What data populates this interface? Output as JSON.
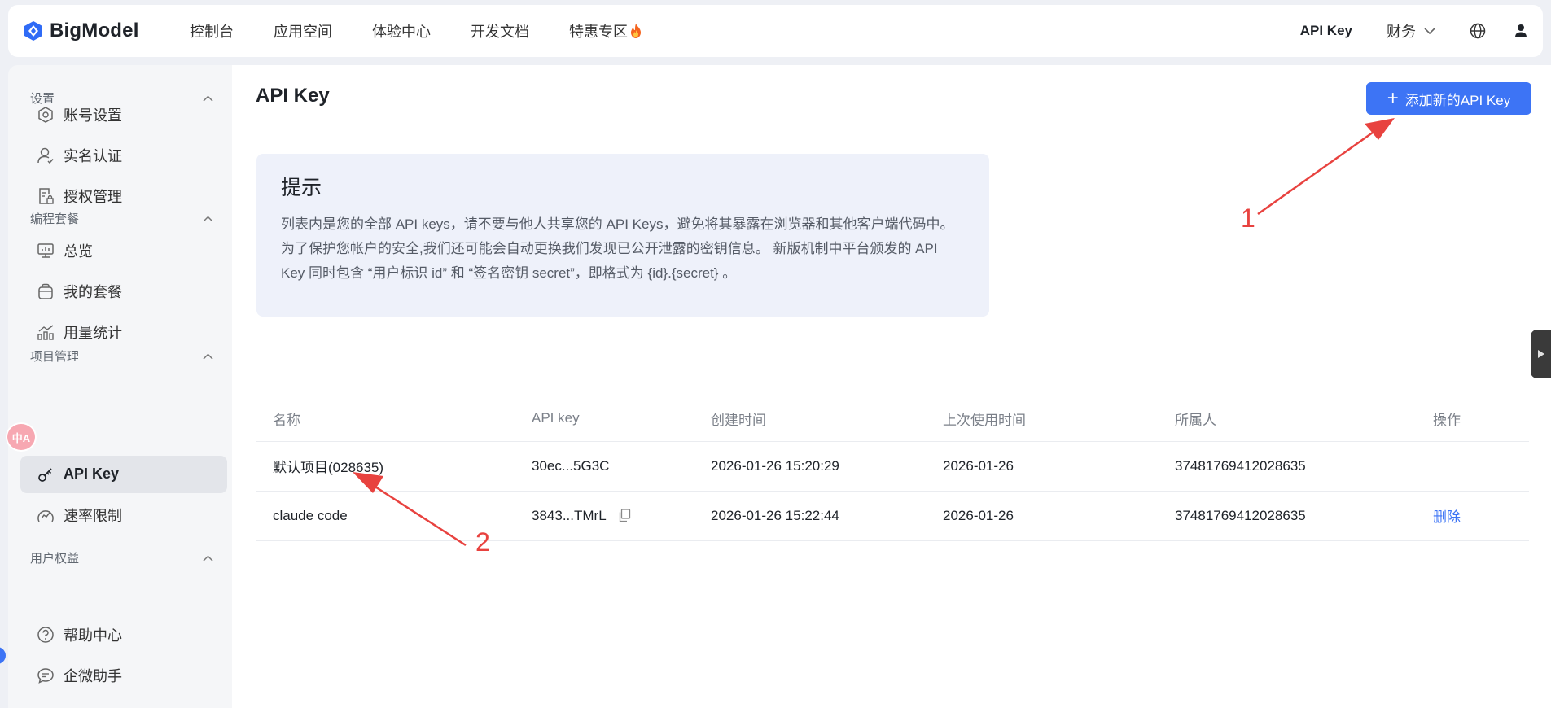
{
  "brand": {
    "name": "BigModel"
  },
  "topnav": {
    "items": [
      "控制台",
      "应用空间",
      "体验中心",
      "开发文档",
      "特惠专区"
    ],
    "fire_icon": "fire-icon",
    "api_key": "API Key",
    "finance": "财务"
  },
  "sidebar": {
    "groups": {
      "settings": "设置",
      "coding": "编程套餐",
      "project": "项目管理",
      "rights": "用户权益"
    },
    "items": {
      "account": "账号设置",
      "realname": "实名认证",
      "auth": "授权管理",
      "overview": "总览",
      "plan": "我的套餐",
      "usage": "用量统计",
      "apikey": "API Key",
      "ratelimit": "速率限制",
      "help": "帮助中心",
      "assistant": "企微助手"
    },
    "translate_badge": "中A"
  },
  "main": {
    "title": "API Key",
    "add_button": "添加新的API Key",
    "tip": {
      "title": "提示",
      "text": "列表内是您的全部 API keys，请不要与他人共享您的 API Keys，避免将其暴露在浏览器和其他客户端代码中。为了保护您帐户的安全,我们还可能会自动更换我们发现已公开泄露的密钥信息。 新版机制中平台颁发的 API Key 同时包含 “用户标识 id” 和 “签名密钥 secret”，即格式为 {id}.{secret} 。"
    },
    "table": {
      "headers": [
        "名称",
        "API key",
        "创建时间",
        "上次使用时间",
        "所属人",
        "操作"
      ],
      "rows": [
        {
          "name": "默认项目(028635)",
          "key": "30ec...5G3C",
          "created": "2026-01-26 15:20:29",
          "last_used": "2026-01-26",
          "owner": "37481769412028635",
          "action": ""
        },
        {
          "name": "claude code",
          "key": "3843...TMrL",
          "created": "2026-01-26 15:22:44",
          "last_used": "2026-01-26",
          "owner": "37481769412028635",
          "action": "删除"
        }
      ]
    }
  },
  "annotations": {
    "one": "1",
    "two": "2",
    "color": "#e8423f"
  },
  "colors": {
    "accent": "#3d74f5",
    "tip_bg": "#eef1fa"
  }
}
